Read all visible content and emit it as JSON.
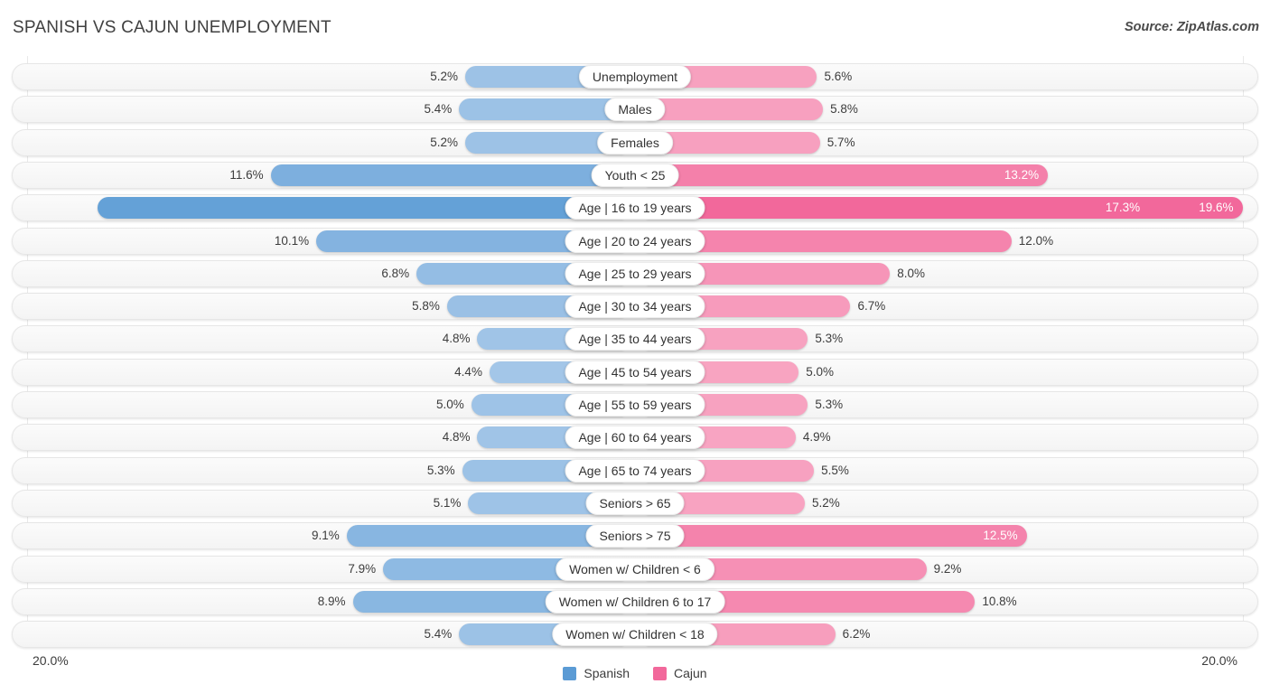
{
  "header": {
    "title": "SPANISH VS CAJUN UNEMPLOYMENT",
    "source": "Source: ZipAtlas.com"
  },
  "axis": {
    "left_max_label": "20.0%",
    "right_max_label": "20.0%",
    "max_value": 20.0
  },
  "legend": {
    "items": [
      {
        "label": "Spanish",
        "color": "#5B9BD5"
      },
      {
        "label": "Cajun",
        "color": "#F2689B"
      }
    ]
  },
  "colors": {
    "spanish_light": "#A3C6E8",
    "spanish_mid": "#7FB0DF",
    "spanish_dark": "#5B9BD5",
    "cajun_light": "#F8A8C4",
    "cajun_mid": "#F587AF",
    "cajun_dark": "#F2689B",
    "track": "#F6F6F6",
    "gridline": "#E9E9E9"
  },
  "chart_data": {
    "type": "bar",
    "orientation": "horizontal-diverging",
    "title": "SPANISH VS CAJUN UNEMPLOYMENT",
    "xlabel": "",
    "ylabel": "",
    "xlim": [
      20.0,
      20.0
    ],
    "grid": true,
    "legend_position": "bottom-center",
    "categories": [
      "Unemployment",
      "Males",
      "Females",
      "Youth < 25",
      "Age | 16 to 19 years",
      "Age | 20 to 24 years",
      "Age | 25 to 29 years",
      "Age | 30 to 34 years",
      "Age | 35 to 44 years",
      "Age | 45 to 54 years",
      "Age | 55 to 59 years",
      "Age | 60 to 64 years",
      "Age | 65 to 74 years",
      "Seniors > 65",
      "Seniors > 75",
      "Women w/ Children < 6",
      "Women w/ Children 6 to 17",
      "Women w/ Children < 18"
    ],
    "series": [
      {
        "name": "Spanish",
        "color": "#5B9BD5",
        "values": [
          5.2,
          5.4,
          5.2,
          11.6,
          17.3,
          10.1,
          6.8,
          5.8,
          4.8,
          4.4,
          5.0,
          4.8,
          5.3,
          5.1,
          9.1,
          7.9,
          8.9,
          5.4
        ],
        "labels": [
          "5.2%",
          "5.4%",
          "5.2%",
          "11.6%",
          "17.3%",
          "10.1%",
          "6.8%",
          "5.8%",
          "4.8%",
          "4.4%",
          "5.0%",
          "4.8%",
          "5.3%",
          "5.1%",
          "9.1%",
          "7.9%",
          "8.9%",
          "5.4%"
        ]
      },
      {
        "name": "Cajun",
        "color": "#F2689B",
        "values": [
          5.6,
          5.8,
          5.7,
          13.2,
          19.6,
          12.0,
          8.0,
          6.7,
          5.3,
          5.0,
          5.3,
          4.9,
          5.5,
          5.2,
          12.5,
          9.2,
          10.8,
          6.2
        ],
        "labels": [
          "5.6%",
          "5.8%",
          "5.7%",
          "13.2%",
          "19.6%",
          "12.0%",
          "8.0%",
          "6.7%",
          "5.3%",
          "5.0%",
          "5.3%",
          "4.9%",
          "5.5%",
          "5.2%",
          "12.5%",
          "9.2%",
          "10.8%",
          "6.2%"
        ]
      }
    ],
    "rows": [
      {
        "category": "Unemployment",
        "left_value": 5.2,
        "left_label": "5.2%",
        "left_inside": false,
        "right_value": 5.6,
        "right_label": "5.6%",
        "right_inside": false
      },
      {
        "category": "Males",
        "left_value": 5.4,
        "left_label": "5.4%",
        "left_inside": false,
        "right_value": 5.8,
        "right_label": "5.8%",
        "right_inside": false
      },
      {
        "category": "Females",
        "left_value": 5.2,
        "left_label": "5.2%",
        "left_inside": false,
        "right_value": 5.7,
        "right_label": "5.7%",
        "right_inside": false
      },
      {
        "category": "Youth < 25",
        "left_value": 11.6,
        "left_label": "11.6%",
        "left_inside": false,
        "right_value": 13.2,
        "right_label": "13.2%",
        "right_inside": true
      },
      {
        "category": "Age | 16 to 19 years",
        "left_value": 17.3,
        "left_label": "17.3%",
        "left_inside": true,
        "right_value": 19.6,
        "right_label": "19.6%",
        "right_inside": true
      },
      {
        "category": "Age | 20 to 24 years",
        "left_value": 10.1,
        "left_label": "10.1%",
        "left_inside": false,
        "right_value": 12.0,
        "right_label": "12.0%",
        "right_inside": false
      },
      {
        "category": "Age | 25 to 29 years",
        "left_value": 6.8,
        "left_label": "6.8%",
        "left_inside": false,
        "right_value": 8.0,
        "right_label": "8.0%",
        "right_inside": false
      },
      {
        "category": "Age | 30 to 34 years",
        "left_value": 5.8,
        "left_label": "5.8%",
        "left_inside": false,
        "right_value": 6.7,
        "right_label": "6.7%",
        "right_inside": false
      },
      {
        "category": "Age | 35 to 44 years",
        "left_value": 4.8,
        "left_label": "4.8%",
        "left_inside": false,
        "right_value": 5.3,
        "right_label": "5.3%",
        "right_inside": false
      },
      {
        "category": "Age | 45 to 54 years",
        "left_value": 4.4,
        "left_label": "4.4%",
        "left_inside": false,
        "right_value": 5.0,
        "right_label": "5.0%",
        "right_inside": false
      },
      {
        "category": "Age | 55 to 59 years",
        "left_value": 5.0,
        "left_label": "5.0%",
        "left_inside": false,
        "right_value": 5.3,
        "right_label": "5.3%",
        "right_inside": false
      },
      {
        "category": "Age | 60 to 64 years",
        "left_value": 4.8,
        "left_label": "4.8%",
        "left_inside": false,
        "right_value": 4.9,
        "right_label": "4.9%",
        "right_inside": false
      },
      {
        "category": "Age | 65 to 74 years",
        "left_value": 5.3,
        "left_label": "5.3%",
        "left_inside": false,
        "right_value": 5.5,
        "right_label": "5.5%",
        "right_inside": false
      },
      {
        "category": "Seniors > 65",
        "left_value": 5.1,
        "left_label": "5.1%",
        "left_inside": false,
        "right_value": 5.2,
        "right_label": "5.2%",
        "right_inside": false
      },
      {
        "category": "Seniors > 75",
        "left_value": 9.1,
        "left_label": "9.1%",
        "left_inside": false,
        "right_value": 12.5,
        "right_label": "12.5%",
        "right_inside": true
      },
      {
        "category": "Women w/ Children < 6",
        "left_value": 7.9,
        "left_label": "7.9%",
        "left_inside": false,
        "right_value": 9.2,
        "right_label": "9.2%",
        "right_inside": false
      },
      {
        "category": "Women w/ Children 6 to 17",
        "left_value": 8.9,
        "left_label": "8.9%",
        "left_inside": false,
        "right_value": 10.8,
        "right_label": "10.8%",
        "right_inside": false
      },
      {
        "category": "Women w/ Children < 18",
        "left_value": 5.4,
        "left_label": "5.4%",
        "left_inside": false,
        "right_value": 6.2,
        "right_label": "6.2%",
        "right_inside": false
      }
    ]
  }
}
